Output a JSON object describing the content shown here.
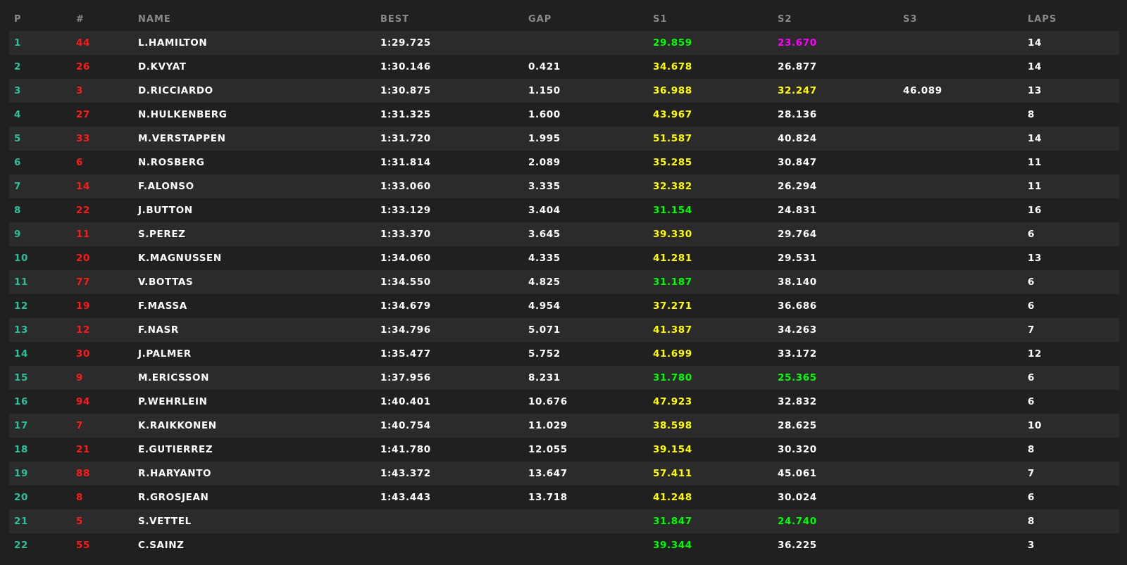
{
  "colors": {
    "background": "#202020",
    "row_alt": "#2b2b2b",
    "header_text": "#8a8a8a",
    "position": "#2cc09a",
    "car_number": "#ff1a1a",
    "personal_best": "#ffff00",
    "session_best_green": "#00ff00",
    "overall_best_purple": "#ff00ff",
    "default_text": "#ffffff"
  },
  "columns": {
    "p": "P",
    "num": "#",
    "name": "NAME",
    "best": "BEST",
    "gap": "GAP",
    "s1": "S1",
    "s2": "S2",
    "s3": "S3",
    "laps": "LAPS"
  },
  "rows": [
    {
      "p": "1",
      "num": "44",
      "name": "L.HAMILTON",
      "best": "1:29.725",
      "gap": "",
      "s1": "29.859",
      "s1_color": "green",
      "s2": "23.670",
      "s2_color": "purple",
      "s3": "",
      "s3_color": "white",
      "laps": "14"
    },
    {
      "p": "2",
      "num": "26",
      "name": "D.KVYAT",
      "best": "1:30.146",
      "gap": "0.421",
      "s1": "34.678",
      "s1_color": "yellow",
      "s2": "26.877",
      "s2_color": "white",
      "s3": "",
      "s3_color": "white",
      "laps": "14"
    },
    {
      "p": "3",
      "num": "3",
      "name": "D.RICCIARDO",
      "best": "1:30.875",
      "gap": "1.150",
      "s1": "36.988",
      "s1_color": "yellow",
      "s2": "32.247",
      "s2_color": "yellow",
      "s3": "46.089",
      "s3_color": "white",
      "laps": "13"
    },
    {
      "p": "4",
      "num": "27",
      "name": "N.HULKENBERG",
      "best": "1:31.325",
      "gap": "1.600",
      "s1": "43.967",
      "s1_color": "yellow",
      "s2": "28.136",
      "s2_color": "white",
      "s3": "",
      "s3_color": "white",
      "laps": "8"
    },
    {
      "p": "5",
      "num": "33",
      "name": "M.VERSTAPPEN",
      "best": "1:31.720",
      "gap": "1.995",
      "s1": "51.587",
      "s1_color": "yellow",
      "s2": "40.824",
      "s2_color": "white",
      "s3": "",
      "s3_color": "white",
      "laps": "14"
    },
    {
      "p": "6",
      "num": "6",
      "name": "N.ROSBERG",
      "best": "1:31.814",
      "gap": "2.089",
      "s1": "35.285",
      "s1_color": "yellow",
      "s2": "30.847",
      "s2_color": "white",
      "s3": "",
      "s3_color": "white",
      "laps": "11"
    },
    {
      "p": "7",
      "num": "14",
      "name": "F.ALONSO",
      "best": "1:33.060",
      "gap": "3.335",
      "s1": "32.382",
      "s1_color": "yellow",
      "s2": "26.294",
      "s2_color": "white",
      "s3": "",
      "s3_color": "white",
      "laps": "11"
    },
    {
      "p": "8",
      "num": "22",
      "name": "J.BUTTON",
      "best": "1:33.129",
      "gap": "3.404",
      "s1": "31.154",
      "s1_color": "green",
      "s2": "24.831",
      "s2_color": "white",
      "s3": "",
      "s3_color": "white",
      "laps": "16"
    },
    {
      "p": "9",
      "num": "11",
      "name": "S.PEREZ",
      "best": "1:33.370",
      "gap": "3.645",
      "s1": "39.330",
      "s1_color": "yellow",
      "s2": "29.764",
      "s2_color": "white",
      "s3": "",
      "s3_color": "white",
      "laps": "6"
    },
    {
      "p": "10",
      "num": "20",
      "name": "K.MAGNUSSEN",
      "best": "1:34.060",
      "gap": "4.335",
      "s1": "41.281",
      "s1_color": "yellow",
      "s2": "29.531",
      "s2_color": "white",
      "s3": "",
      "s3_color": "white",
      "laps": "13"
    },
    {
      "p": "11",
      "num": "77",
      "name": "V.BOTTAS",
      "best": "1:34.550",
      "gap": "4.825",
      "s1": "31.187",
      "s1_color": "green",
      "s2": "38.140",
      "s2_color": "white",
      "s3": "",
      "s3_color": "white",
      "laps": "6"
    },
    {
      "p": "12",
      "num": "19",
      "name": "F.MASSA",
      "best": "1:34.679",
      "gap": "4.954",
      "s1": "37.271",
      "s1_color": "yellow",
      "s2": "36.686",
      "s2_color": "white",
      "s3": "",
      "s3_color": "white",
      "laps": "6"
    },
    {
      "p": "13",
      "num": "12",
      "name": "F.NASR",
      "best": "1:34.796",
      "gap": "5.071",
      "s1": "41.387",
      "s1_color": "yellow",
      "s2": "34.263",
      "s2_color": "white",
      "s3": "",
      "s3_color": "white",
      "laps": "7"
    },
    {
      "p": "14",
      "num": "30",
      "name": "J.PALMER",
      "best": "1:35.477",
      "gap": "5.752",
      "s1": "41.699",
      "s1_color": "yellow",
      "s2": "33.172",
      "s2_color": "white",
      "s3": "",
      "s3_color": "white",
      "laps": "12"
    },
    {
      "p": "15",
      "num": "9",
      "name": "M.ERICSSON",
      "best": "1:37.956",
      "gap": "8.231",
      "s1": "31.780",
      "s1_color": "green",
      "s2": "25.365",
      "s2_color": "green",
      "s3": "",
      "s3_color": "white",
      "laps": "6"
    },
    {
      "p": "16",
      "num": "94",
      "name": "P.WEHRLEIN",
      "best": "1:40.401",
      "gap": "10.676",
      "s1": "47.923",
      "s1_color": "yellow",
      "s2": "32.832",
      "s2_color": "white",
      "s3": "",
      "s3_color": "white",
      "laps": "6"
    },
    {
      "p": "17",
      "num": "7",
      "name": "K.RAIKKONEN",
      "best": "1:40.754",
      "gap": "11.029",
      "s1": "38.598",
      "s1_color": "yellow",
      "s2": "28.625",
      "s2_color": "white",
      "s3": "",
      "s3_color": "white",
      "laps": "10"
    },
    {
      "p": "18",
      "num": "21",
      "name": "E.GUTIERREZ",
      "best": "1:41.780",
      "gap": "12.055",
      "s1": "39.154",
      "s1_color": "yellow",
      "s2": "30.320",
      "s2_color": "white",
      "s3": "",
      "s3_color": "white",
      "laps": "8"
    },
    {
      "p": "19",
      "num": "88",
      "name": "R.HARYANTO",
      "best": "1:43.372",
      "gap": "13.647",
      "s1": "57.411",
      "s1_color": "yellow",
      "s2": "45.061",
      "s2_color": "white",
      "s3": "",
      "s3_color": "white",
      "laps": "7"
    },
    {
      "p": "20",
      "num": "8",
      "name": "R.GROSJEAN",
      "best": "1:43.443",
      "gap": "13.718",
      "s1": "41.248",
      "s1_color": "yellow",
      "s2": "30.024",
      "s2_color": "white",
      "s3": "",
      "s3_color": "white",
      "laps": "6"
    },
    {
      "p": "21",
      "num": "5",
      "name": "S.VETTEL",
      "best": "",
      "gap": "",
      "s1": "31.847",
      "s1_color": "green",
      "s2": "24.740",
      "s2_color": "green",
      "s3": "",
      "s3_color": "white",
      "laps": "8"
    },
    {
      "p": "22",
      "num": "55",
      "name": "C.SAINZ",
      "best": "",
      "gap": "",
      "s1": "39.344",
      "s1_color": "green",
      "s2": "36.225",
      "s2_color": "white",
      "s3": "",
      "s3_color": "white",
      "laps": "3"
    }
  ]
}
